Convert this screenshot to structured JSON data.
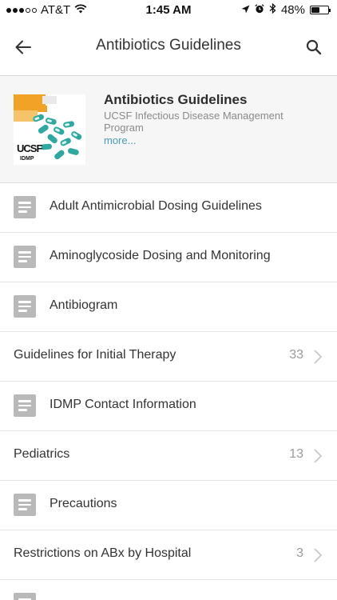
{
  "status_bar": {
    "carrier": "AT&T",
    "time": "1:45 AM",
    "battery": "48%",
    "battery_level": 0.48
  },
  "nav": {
    "title": "Antibiotics Guidelines"
  },
  "header": {
    "title": "Antibiotics Guidelines",
    "subtitle": "UCSF Infectious Disease Management Program",
    "more": "more...",
    "logo_text": "UCSF",
    "logo_sub": "IDMP"
  },
  "list": [
    {
      "label": "Adult Antimicrobial Dosing Guidelines",
      "icon": "document-icon"
    },
    {
      "label": "Aminoglycoside Dosing and Monitoring",
      "icon": "document-icon"
    },
    {
      "label": "Antibiogram",
      "icon": "document-icon"
    },
    {
      "label": "Guidelines for Initial Therapy",
      "count": "33",
      "icon": "chevron-right-icon"
    },
    {
      "label": "IDMP Contact Information",
      "icon": "document-icon"
    },
    {
      "label": "Pediatrics",
      "count": "13",
      "icon": "chevron-right-icon"
    },
    {
      "label": "Precautions",
      "icon": "document-icon"
    },
    {
      "label": "Restrictions on ABx by Hospital",
      "count": "3",
      "icon": "chevron-right-icon"
    },
    {
      "label": "",
      "icon": "document-icon"
    }
  ],
  "colors": {
    "accent": "#4a9bb5",
    "doc_icon": "#b9b9b9",
    "header_bg": "#f6f6f6"
  }
}
